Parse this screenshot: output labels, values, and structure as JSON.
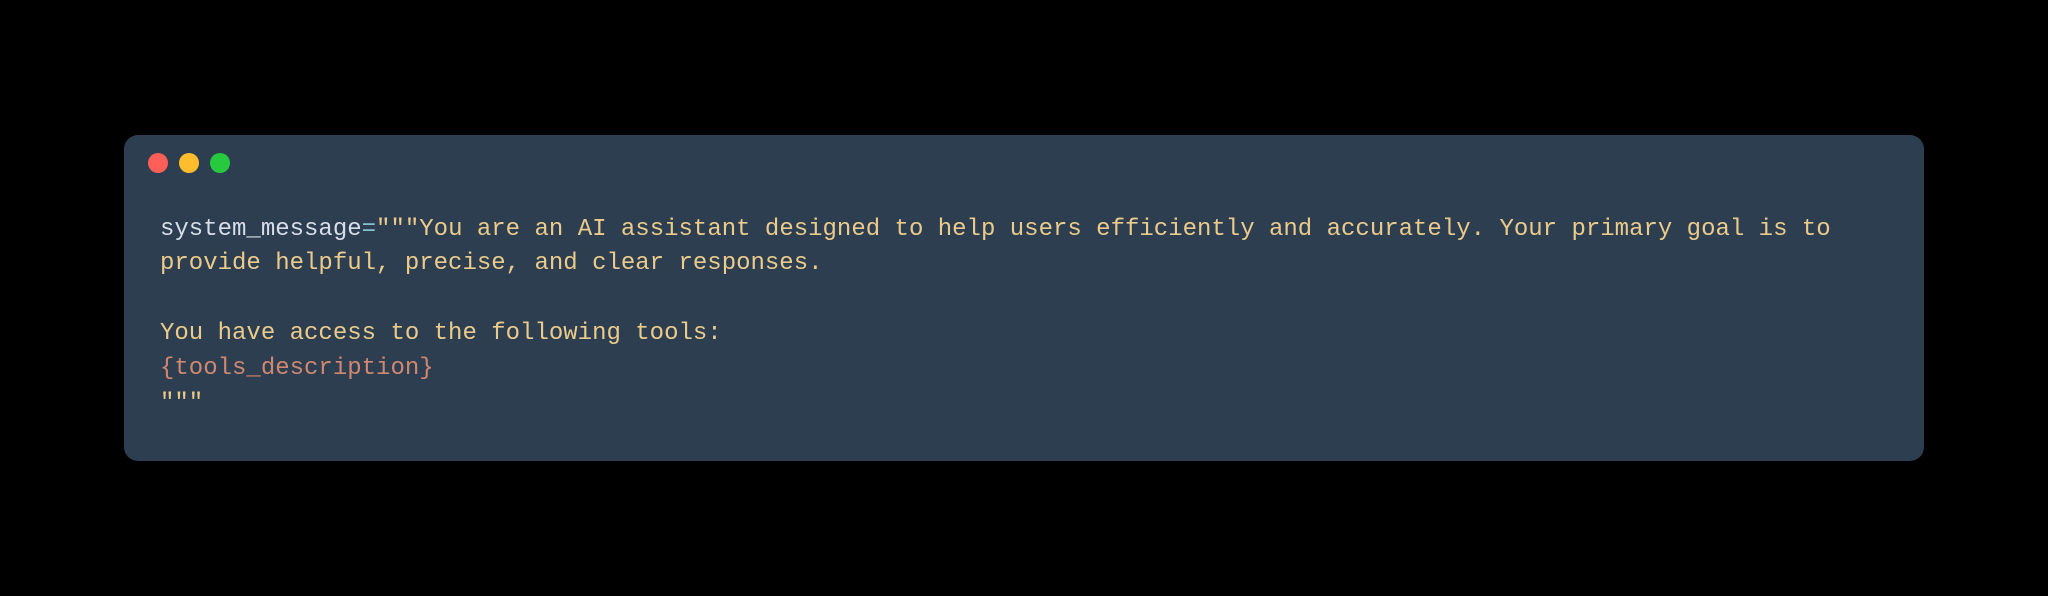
{
  "code": {
    "var_name": "system_message",
    "operator": "=",
    "string_open": "\"\"\"",
    "line1": "You are an AI assistant designed to help users efficiently and accurately. Your primary goal is to provide helpful, precise, and clear responses.",
    "line2_blank": "",
    "line3": "You have access to the following tools:",
    "placeholder": "{tools_description}",
    "string_close": "\"\"\""
  },
  "traffic_lights": {
    "red": "close",
    "yellow": "minimize",
    "green": "maximize"
  }
}
